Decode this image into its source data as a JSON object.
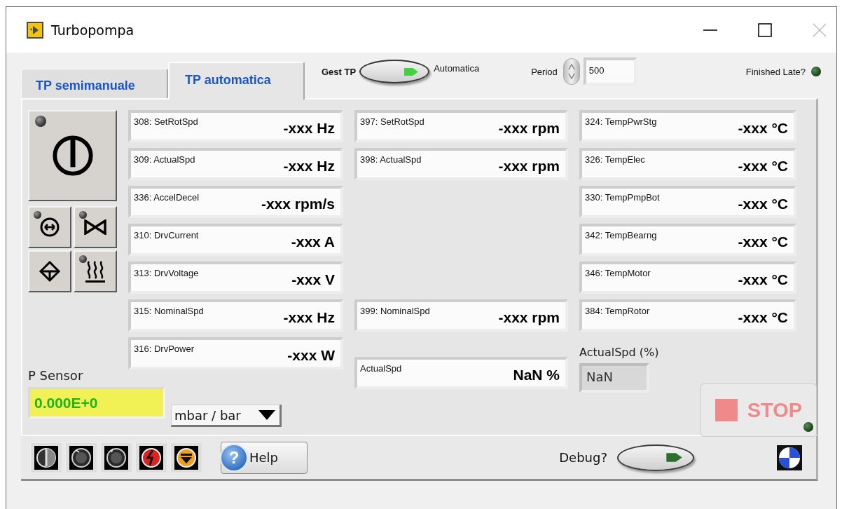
{
  "window": {
    "title": "Turbopompa"
  },
  "tabs": [
    {
      "label": "TP semimanuale",
      "selected": false
    },
    {
      "label": "TP automatica",
      "selected": true
    }
  ],
  "gest_tp": {
    "label": "Gest TP",
    "on": true,
    "state_label": "Automatica"
  },
  "period": {
    "label": "Period",
    "value": "500"
  },
  "finished_late": {
    "label": "Finished Late?",
    "on": false
  },
  "command_buttons": [
    {
      "kind": "power",
      "led": true
    },
    {
      "kind": "exchange",
      "led": true
    },
    {
      "kind": "valve",
      "led": true
    },
    {
      "kind": "vent",
      "led": false
    },
    {
      "kind": "heater",
      "led": true
    }
  ],
  "drive_readouts": [
    {
      "label": "308: SetRotSpd",
      "value": "-xxx Hz"
    },
    {
      "label": "309: ActualSpd",
      "value": "-xxx Hz"
    },
    {
      "label": "336: AccelDecel",
      "value": "-xxx rpm/s"
    },
    {
      "label": "310: DrvCurrent",
      "value": "-xxx A"
    },
    {
      "label": "313: DrvVoltage",
      "value": "-xxx V"
    },
    {
      "label": "315: NominalSpd",
      "value": "-xxx Hz"
    },
    {
      "label": "316: DrvPower",
      "value": "-xxx W"
    }
  ],
  "rpm_readouts": {
    "top": [
      {
        "label": "397: SetRotSpd",
        "value": "-xxx rpm"
      },
      {
        "label": "398: ActualSpd",
        "value": "-xxx rpm"
      }
    ],
    "nominal": {
      "label": "399: NominalSpd",
      "value": "-xxx rpm"
    }
  },
  "actual_spd": {
    "label": "ActualSpd",
    "value": "NaN %"
  },
  "temperature_readouts": [
    {
      "label": "324: TempPwrStg",
      "value": "-xxx °C"
    },
    {
      "label": "326: TempElec",
      "value": "-xxx °C"
    },
    {
      "label": "330: TempPmpBot",
      "value": "-xxx °C"
    },
    {
      "label": "342: TempBearng",
      "value": "-xxx °C"
    },
    {
      "label": "346: TempMotor",
      "value": "-xxx °C"
    },
    {
      "label": "384: TempRotor",
      "value": "-xxx °C"
    }
  ],
  "actual_spd_pct": {
    "label": "ActualSpd (%)",
    "value": "NaN"
  },
  "p_sensor": {
    "label": "P Sensor",
    "value": "0.000E+0",
    "unit": "mbar / bar"
  },
  "stop_button": {
    "label": "STOP",
    "disabled": true,
    "led_on": false
  },
  "help_button": {
    "icon": "?",
    "label": "Help"
  },
  "debug": {
    "label": "Debug?",
    "on": false
  }
}
